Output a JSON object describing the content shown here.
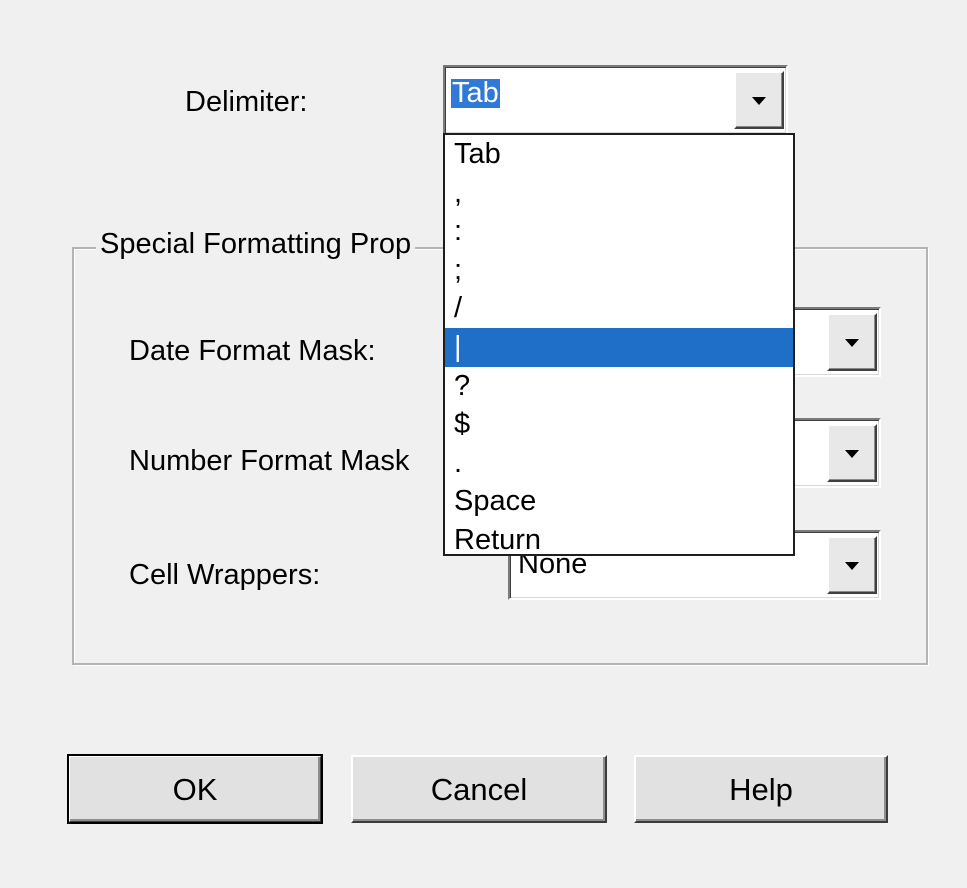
{
  "dialog": {
    "delimiter_label": "Delimiter:",
    "delimiter_value": "Tab",
    "delimiter_options": [
      "Tab",
      ",",
      ":",
      ";",
      "/",
      "|",
      "?",
      "$",
      ".",
      "Space",
      "Return"
    ],
    "highlighted_option": "|",
    "group_title": "Special Formatting Prop",
    "date_format_label": "Date Format Mask:",
    "number_format_label": "Number Format Mask",
    "cell_wrappers_label": "Cell Wrappers:",
    "cell_wrappers_value": "None",
    "ok_label": "OK",
    "cancel_label": "Cancel",
    "help_label": "Help"
  },
  "icons": {
    "dropdown_arrow": "chevron-down-icon"
  },
  "colors": {
    "selection": "#1f6fc9",
    "background": "#f0f0f0"
  }
}
